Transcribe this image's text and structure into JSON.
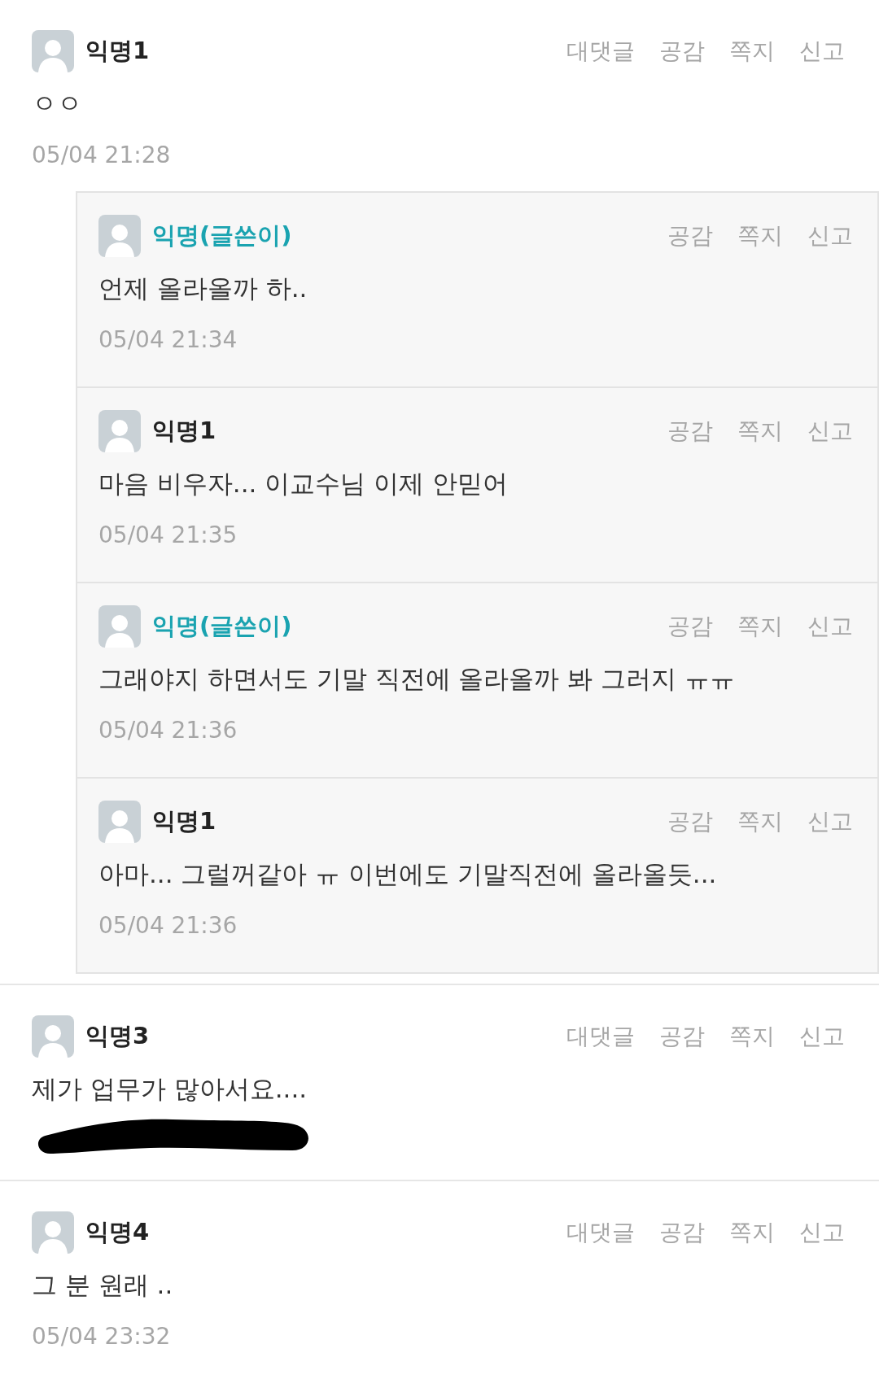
{
  "comments": [
    {
      "author": "익명1",
      "writer": false,
      "actions": [
        "대댓글",
        "공감",
        "쪽지",
        "신고"
      ],
      "body": "ㅇㅇ",
      "time": "05/04 21:28",
      "redacted": false,
      "replies": [
        {
          "author": "익명(글쓴이)",
          "writer": true,
          "actions": [
            "공감",
            "쪽지",
            "신고"
          ],
          "body": "언제 올라올까 하..",
          "time": "05/04 21:34"
        },
        {
          "author": "익명1",
          "writer": false,
          "actions": [
            "공감",
            "쪽지",
            "신고"
          ],
          "body": "마음 비우자... 이교수님 이제 안믿어",
          "time": "05/04 21:35"
        },
        {
          "author": "익명(글쓴이)",
          "writer": true,
          "actions": [
            "공감",
            "쪽지",
            "신고"
          ],
          "body": "그래야지 하면서도 기말 직전에 올라올까 봐 그러지 ㅠㅠ",
          "time": "05/04 21:36"
        },
        {
          "author": "익명1",
          "writer": false,
          "actions": [
            "공감",
            "쪽지",
            "신고"
          ],
          "body": "아마... 그럴꺼같아 ㅠ 이번에도 기말직전에 올라올듯...",
          "time": "05/04 21:36"
        }
      ]
    },
    {
      "author": "익명3",
      "writer": false,
      "actions": [
        "대댓글",
        "공감",
        "쪽지",
        "신고"
      ],
      "body": "제가 업무가 많아서요....",
      "redacted": true
    },
    {
      "author": "익명4",
      "writer": false,
      "actions": [
        "대댓글",
        "공감",
        "쪽지",
        "신고"
      ],
      "body": "그 분 원래 ..",
      "time": "05/04 23:32",
      "redacted": false
    }
  ]
}
